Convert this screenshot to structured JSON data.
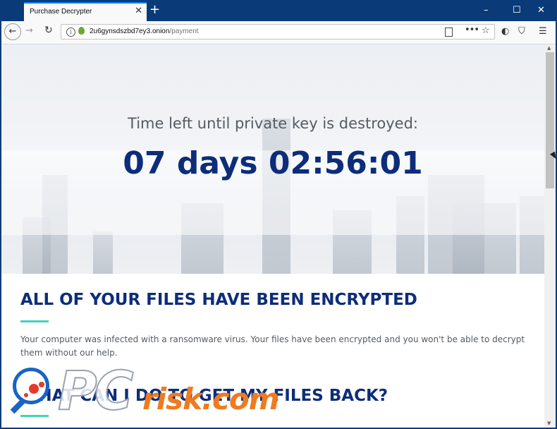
{
  "browser": {
    "tab_title": "Purchase Decrypter",
    "tab_close_glyph": "✕",
    "new_tab_glyph": "+",
    "window_controls": {
      "minimize": "–",
      "maximize": "☐",
      "close": "✕"
    },
    "url_host": "2u6gynsdszbd7ey3.onion",
    "url_path": "/payment",
    "icons": [
      "back-arrow-icon",
      "forward-arrow-icon",
      "reload-icon",
      "info-icon",
      "onion-icon",
      "reader-view-icon",
      "page-actions-icon",
      "bookmark-star-icon",
      "tracking-protection-icon",
      "shield-icon",
      "hamburger-menu-icon"
    ]
  },
  "hero": {
    "timer_label": "Time left until private key is destroyed:",
    "timer": "07 days 02:56:01"
  },
  "section1": {
    "heading": "ALL OF YOUR FILES HAVE BEEN ENCRYPTED",
    "body": "Your computer was infected with a ransomware virus. Your files have been encrypted and you won't be able to decrypt them without our help."
  },
  "section2": {
    "heading": "WHAT CAN I DO TO GET MY FILES BACK?"
  },
  "colors": {
    "heading_blue": "#0d2d7a",
    "accent_teal": "#3fd4c1",
    "window_frame": "#0a3a78"
  },
  "watermark": {
    "part1": "PC",
    "part2": "risk.com"
  }
}
